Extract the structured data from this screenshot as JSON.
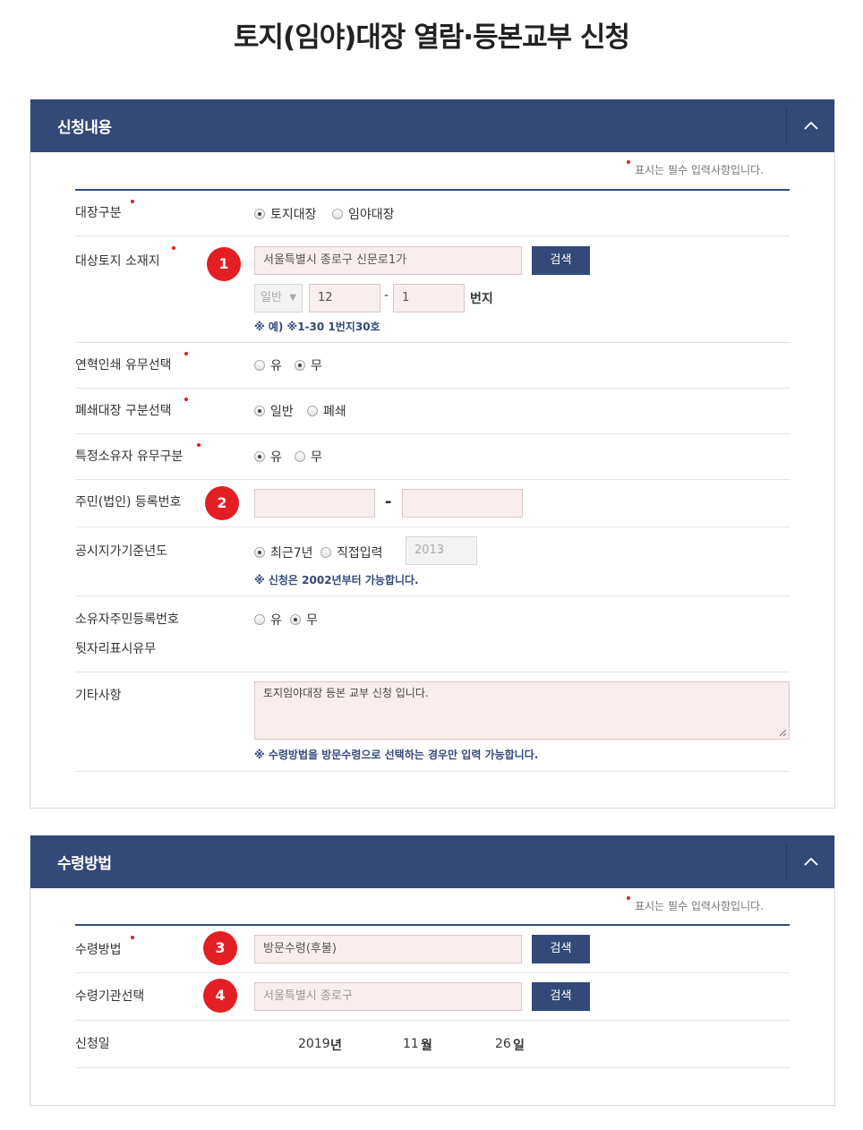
{
  "page_title": "토지(임야)대장 열람·등본교부 신청",
  "required_note": "표시는 필수 입력사항입니다.",
  "section1": {
    "title": "신청내용",
    "ledger_type": {
      "label": "대장구분",
      "options": [
        "토지대장",
        "임야대장"
      ]
    },
    "location": {
      "label": "대상토지 소재지",
      "badge": "1",
      "address": "서울특별시 종로구 신문로1가",
      "search_button": "검색",
      "lot_type": "일반",
      "lot_main": "12",
      "lot_sub": "1",
      "dash": "-",
      "unit": "번지",
      "hint": "※ 예) ※1-30 1번지30호"
    },
    "history_print": {
      "label": "연혁인쇄 유무선택",
      "options": [
        "유",
        "무"
      ]
    },
    "closed_ledger": {
      "label": "폐쇄대장 구분선택",
      "options": [
        "일반",
        "폐쇄"
      ]
    },
    "special_owner": {
      "label": "특정소유자 유무구분",
      "options": [
        "유",
        "무"
      ]
    },
    "resident_no": {
      "label": "주민(법인) 등록번호",
      "badge": "2",
      "dash": "-"
    },
    "land_price_year": {
      "label": "공시지가기준년도",
      "options": [
        "최근7년",
        "직접입력"
      ],
      "year_value": "2013",
      "hint": "※ 신청은 2002년부터 가능합니다."
    },
    "owner_id_display": {
      "label_line1": "소유자주민등록번호",
      "label_line2": "뒷자리표시유무",
      "options": [
        "유",
        "무"
      ]
    },
    "etc": {
      "label": "기타사항",
      "value": "토지임야대장 등본 교부 신청 입니다.",
      "hint": "※ 수령방법을 방문수령으로 선택하는 경우만 입력 가능합니다."
    }
  },
  "section2": {
    "title": "수령방법",
    "method": {
      "label": "수령방법",
      "badge": "3",
      "value": "방문수령(후불)",
      "search_button": "검색"
    },
    "office": {
      "label": "수령기관선택",
      "badge": "4",
      "placeholder": "서울특별시 종로구",
      "search_button": "검색"
    },
    "apply_date": {
      "label": "신청일",
      "year": "2019",
      "year_unit": "년",
      "month": "11",
      "month_unit": "월",
      "day": "26",
      "day_unit": "일"
    }
  },
  "colors": {
    "header": "#334a79",
    "badge": "#e31e24",
    "input_bg": "#f9eeee"
  }
}
